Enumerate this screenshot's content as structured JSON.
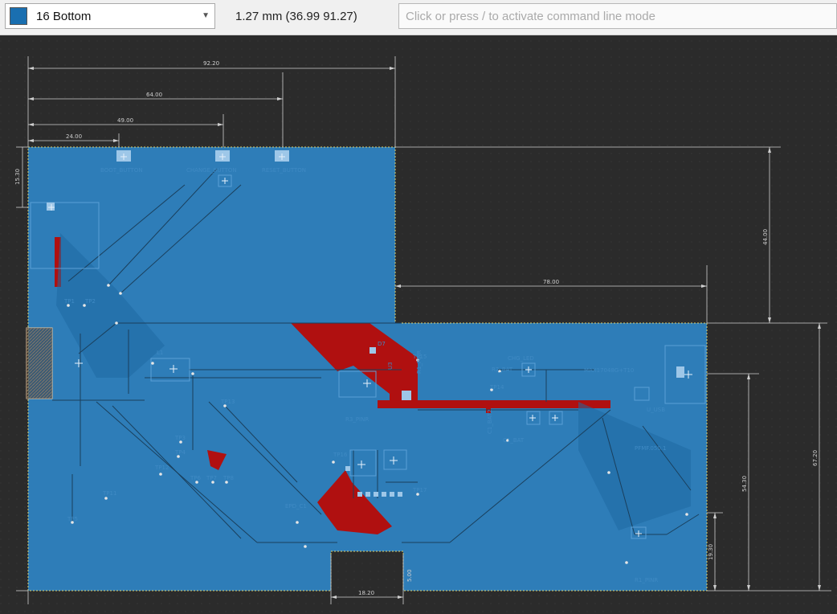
{
  "toolbar": {
    "layer": {
      "label": "16 Bottom",
      "color": "#1a6fb0"
    },
    "coordinate_readout": "1.27 mm (36.99 91.27)",
    "command_placeholder": "Click or press / to activate command line mode",
    "command_value": ""
  },
  "colors": {
    "background": "#2b2b2b",
    "copper_bottom": "#2e7db8",
    "copper_top": "#b01010",
    "dimension": "#cfcfcf",
    "silkscreen": "#3f8ac4"
  },
  "dimensions": {
    "board_width": "92.20",
    "button3_offset": "64.00",
    "button2_offset": "49.00",
    "button1_offset": "24.00",
    "top_notch_depth": "15.30",
    "right_notch_height": "44.00",
    "right_notch_width": "78.00",
    "lower_section_height": "67.20",
    "usb_offset": "54.30",
    "mount_offset": "19.30",
    "bottom_cutout_width": "18.20",
    "bottom_cutout_height": "5.00"
  },
  "labels": {
    "boot_button": "BOOT_BUTTON",
    "change_button": "CHANGE_BUTTON",
    "reset_button": "RESET_BUTTON",
    "tp1": "TP1",
    "tp2": "TP2",
    "tp8": "TP8",
    "tp4": "TP4",
    "tp12": "TP12",
    "tp11": "TP11",
    "tp13": "TP13",
    "tp14": "TP14",
    "tp15": "TP15",
    "tp16": "TP16",
    "tp17": "TP17",
    "tp6": "TP6",
    "tp7": "TP7",
    "tp5": "TP5",
    "tp3": "TP3",
    "l1": "L1",
    "u3": "U3",
    "r3_pinr": "R3_PINR",
    "r1_pinr": "R1_PINR",
    "chg_led": "CHG_LED",
    "max": "MAX17048G+T10",
    "u_usb": "U_USB",
    "epd_c1": "EPD_C1",
    "pfmf": "PFMF.050.1",
    "r2_bat": "R2_BAT",
    "c1_bat": "C1_BAT",
    "c1_bat2": "C1_BAT2",
    "r1_pinr2": "R1_PINR",
    "d7": "D7"
  }
}
